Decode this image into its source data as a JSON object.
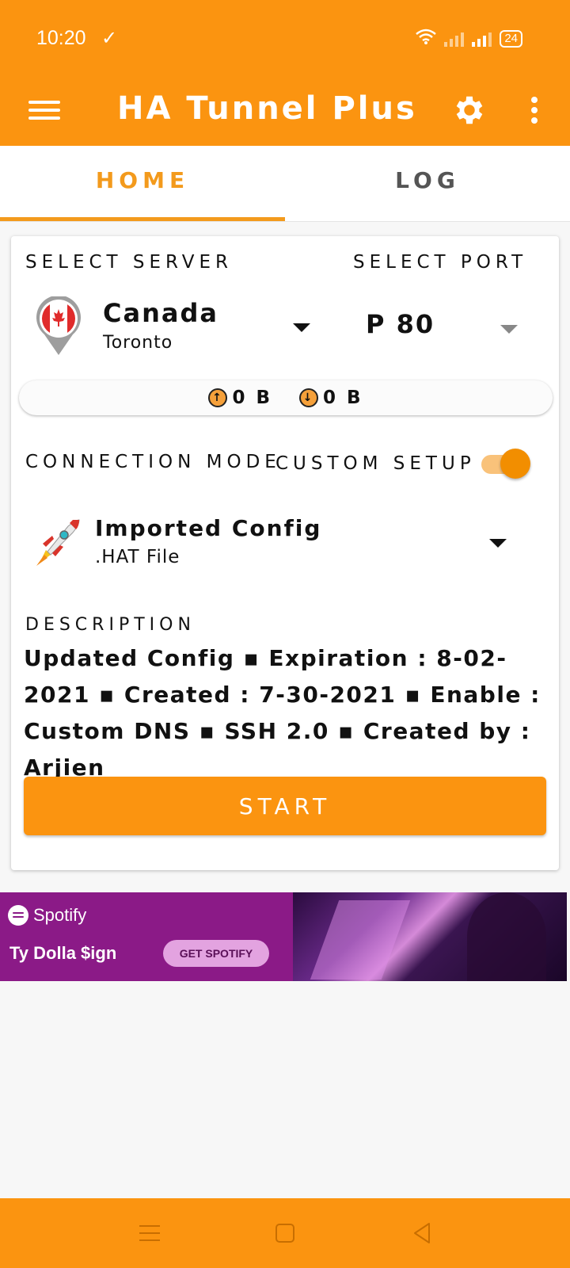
{
  "status_bar": {
    "time": "10:20",
    "battery": "24"
  },
  "app_bar": {
    "title": "HA Tunnel Plus"
  },
  "tabs": [
    {
      "label": "HOME",
      "active": true
    },
    {
      "label": "LOG",
      "active": false
    }
  ],
  "server": {
    "select_label": "SELECT SERVER",
    "country": "Canada",
    "city": "Toronto"
  },
  "port": {
    "select_label": "SELECT PORT",
    "value": "P 80"
  },
  "traffic": {
    "upload": "0 B",
    "download": "0 B"
  },
  "connection": {
    "mode_label": "CONNECTION MODE",
    "custom_setup_label": "CUSTOM SETUP",
    "custom_setup_enabled": true
  },
  "config": {
    "name": "Imported Config",
    "type": ".HAT File"
  },
  "description": {
    "label": "DESCRIPTION",
    "text": "Updated Config ▪ Expiration : 8-02-2021 ▪ Created : 7-30-2021 ▪ Enable : Custom DNS ▪ SSH 2.0 ▪ Created by : Arjien"
  },
  "start_button": {
    "label": "START"
  },
  "ad": {
    "brand": "Spotify",
    "artist": "Ty Dolla $ign",
    "cta": "GET SPOTIFY"
  },
  "colors": {
    "accent": "#fb9410",
    "tab_active": "#f39a1c"
  }
}
